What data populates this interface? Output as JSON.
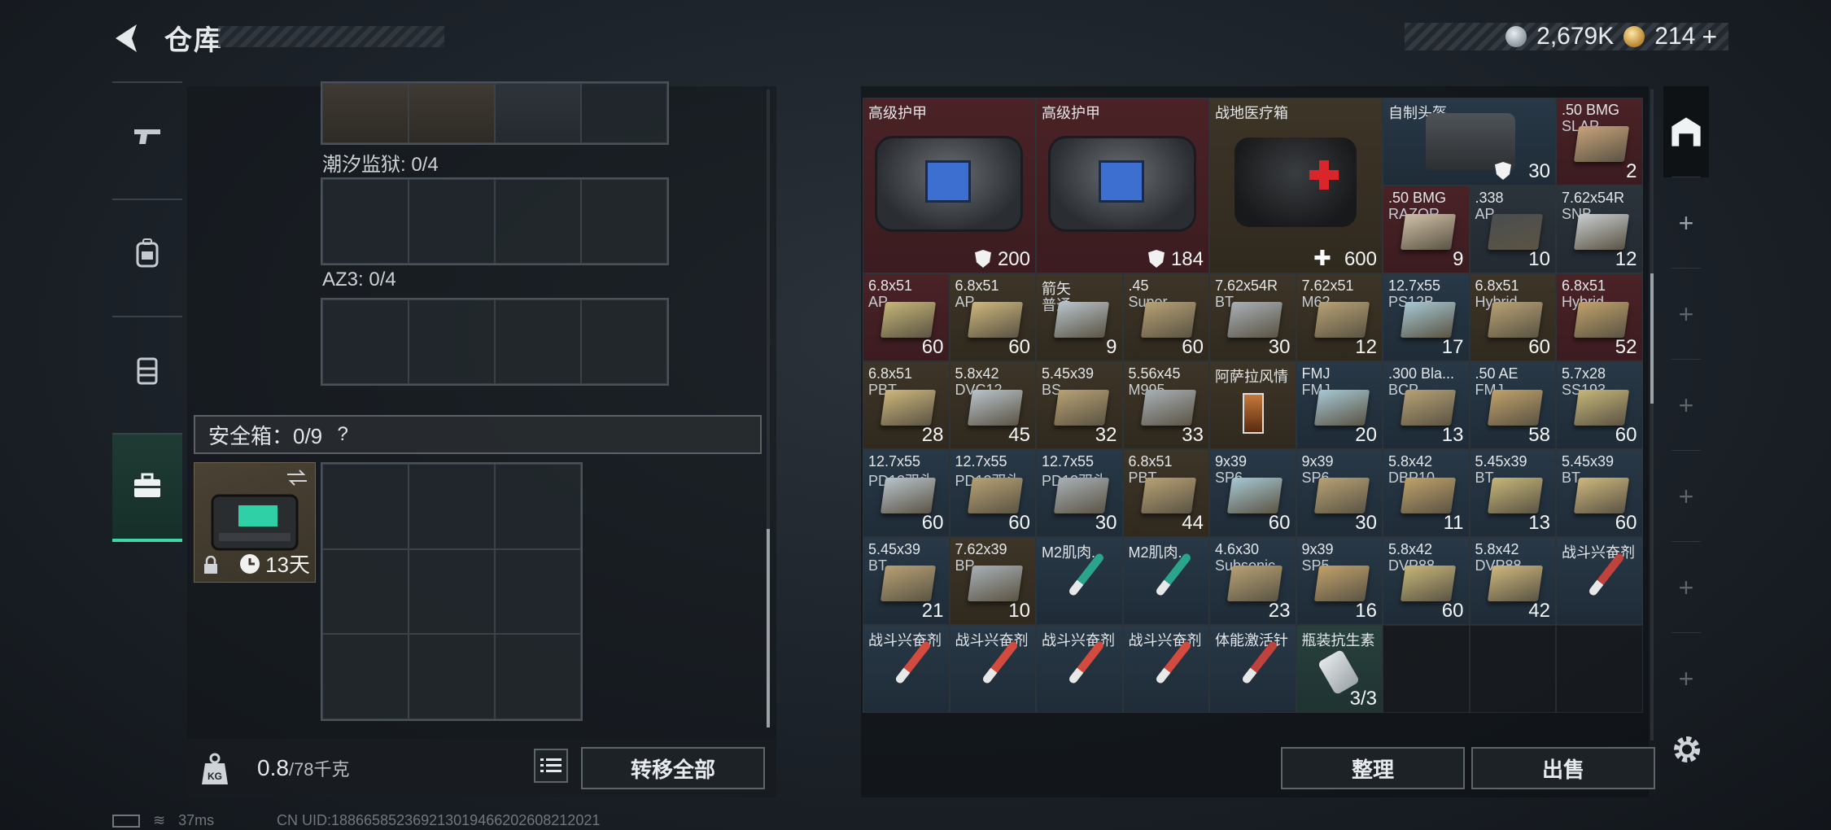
{
  "header": {
    "title": "仓库"
  },
  "currency": [
    {
      "icon": "silver-coin-icon",
      "value": "2,679K"
    },
    {
      "icon": "gold-coin-icon",
      "value": "214"
    }
  ],
  "currency_plus": "+",
  "left_tabs": [
    {
      "icon": "pistol-icon"
    },
    {
      "icon": "backpack-icon"
    },
    {
      "icon": "rig-icon"
    },
    {
      "icon": "safebox-icon",
      "active": true
    }
  ],
  "containers": [
    {
      "label": "潮汐监狱: 0/4"
    },
    {
      "label": "AZ3: 0/4"
    }
  ],
  "safebox": {
    "label": "安全箱：0/9",
    "help": "?",
    "timer": "13天"
  },
  "weight": {
    "value": "0.8",
    "unit": "/78千克",
    "icon_label": "KG"
  },
  "buttons": {
    "transfer_all": "转移全部",
    "sort": "整理",
    "sell": "出售"
  },
  "status": {
    "ping": "37ms",
    "uid": "CN UID:18866585236921301946620260821​2021"
  },
  "warehouse": {
    "row1": [
      {
        "name": "高级护甲",
        "count": "200",
        "badge": "armor"
      },
      {
        "name": "高级护甲",
        "count": "184",
        "badge": "armor"
      },
      {
        "name": "战地医疗箱",
        "count": "600",
        "badge": "heal"
      },
      {
        "name": "自制头盔",
        "count": "30",
        "badge": "armor"
      },
      {
        "name": ".50 BMG",
        "sub": "SLAP",
        "count": "2"
      }
    ],
    "row1b": [
      {
        "name": ".50 BMG",
        "sub": "RAZOR",
        "count": "9"
      },
      {
        "name": ".338",
        "sub": "AP",
        "count": "10"
      },
      {
        "name": "7.62x54R",
        "sub": "SNB",
        "count": "12"
      }
    ],
    "row2": [
      {
        "name": "6.8x51",
        "sub": "AP",
        "count": "60"
      },
      {
        "name": "6.8x51",
        "sub": "AP",
        "count": "60"
      },
      {
        "name": "箭矢",
        "sub": "普通",
        "count": "9"
      },
      {
        "name": ".45",
        "sub": "Super",
        "count": "60"
      },
      {
        "name": "7.62x54R",
        "sub": "BT",
        "count": "30"
      },
      {
        "name": "7.62x51",
        "sub": "M62",
        "count": "12"
      },
      {
        "name": "12.7x55",
        "sub": "PS12B",
        "count": "17"
      },
      {
        "name": "6.8x51",
        "sub": "Hybrid",
        "count": "60"
      },
      {
        "name": "6.8x51",
        "sub": "Hybrid",
        "count": "52"
      }
    ],
    "row3": [
      {
        "name": "6.8x51",
        "sub": "PBT",
        "count": "28"
      },
      {
        "name": "5.8x42",
        "sub": "DVC12",
        "count": "45"
      },
      {
        "name": "5.45x39",
        "sub": "BS",
        "count": "32"
      },
      {
        "name": "5.56x45",
        "sub": "M995",
        "count": "33"
      },
      {
        "name": "阿萨拉风情",
        "sub": "",
        "count": ""
      },
      {
        "name": "FMJ",
        "sub": "FMJ",
        "count": "20"
      },
      {
        "name": ".300 Bla...",
        "sub": "BCP",
        "count": "13"
      },
      {
        "name": ".50 AE",
        "sub": "FMJ",
        "count": "58"
      },
      {
        "name": "5.7x28",
        "sub": "SS193",
        "count": "60"
      }
    ],
    "row4": [
      {
        "name": "12.7x55",
        "sub": "PD12双头",
        "count": "60"
      },
      {
        "name": "12.7x55",
        "sub": "PD12双头",
        "count": "60"
      },
      {
        "name": "12.7x55",
        "sub": "PD12双头",
        "count": "30"
      },
      {
        "name": "6.8x51",
        "sub": "PBT",
        "count": "44"
      },
      {
        "name": "9x39",
        "sub": "SP6",
        "count": "60"
      },
      {
        "name": "9x39",
        "sub": "SP6",
        "count": "30"
      },
      {
        "name": "5.8x42",
        "sub": "DBP10",
        "count": "11"
      },
      {
        "name": "5.45x39",
        "sub": "BT",
        "count": "13"
      },
      {
        "name": "5.45x39",
        "sub": "BT",
        "count": "60"
      }
    ],
    "row5": [
      {
        "name": "5.45x39",
        "sub": "BT",
        "count": "21"
      },
      {
        "name": "7.62x39",
        "sub": "BP",
        "count": "10"
      },
      {
        "name": "M2肌肉...",
        "sub": "",
        "count": ""
      },
      {
        "name": "M2肌肉...",
        "sub": "",
        "count": ""
      },
      {
        "name": "4.6x30",
        "sub": "Subsonic",
        "count": "23"
      },
      {
        "name": "9x39",
        "sub": "SP5",
        "count": "16"
      },
      {
        "name": "5.8x42",
        "sub": "DVP88",
        "count": "60"
      },
      {
        "name": "5.8x42",
        "sub": "DVP88",
        "count": "42"
      },
      {
        "name": "战斗兴奋剂",
        "sub": "",
        "count": ""
      }
    ],
    "row6": [
      {
        "name": "战斗兴奋剂",
        "count": ""
      },
      {
        "name": "战斗兴奋剂",
        "count": ""
      },
      {
        "name": "战斗兴奋剂",
        "count": ""
      },
      {
        "name": "战斗兴奋剂",
        "count": ""
      },
      {
        "name": "体能激活针",
        "count": ""
      },
      {
        "name": "瓶装抗生素",
        "count": "3/3"
      }
    ]
  },
  "colors": {
    "accent": "#3fd6a8",
    "rarity_red": "#4a2226",
    "rarity_blue": "#283846",
    "rarity_brown": "#3d3527"
  }
}
